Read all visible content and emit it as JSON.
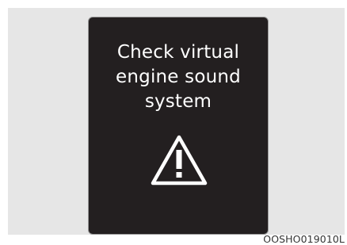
{
  "panel": {
    "message_lines": [
      "Check virtual",
      "engine sound",
      "system"
    ],
    "icon": "warning-triangle-icon",
    "background_color": "#231f20",
    "text_color": "#ffffff"
  },
  "image_code": "OOSHO019010L"
}
